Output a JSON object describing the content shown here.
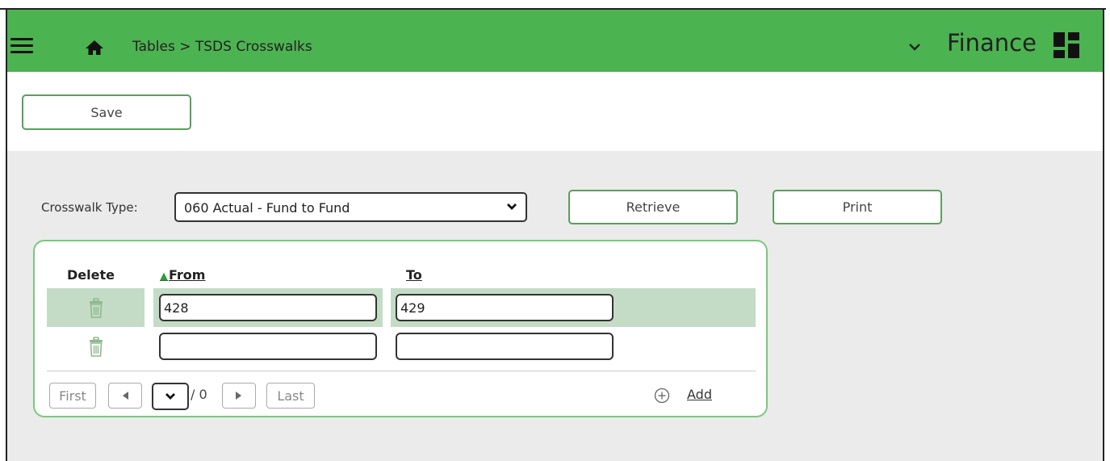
{
  "header": {
    "breadcrumb": "Tables > TSDS Crosswalks",
    "app_title": "Finance",
    "colors": {
      "header_bg": "#4cb351",
      "accent_border": "#5b9e5e",
      "row_highlight": "#c4dcc6"
    },
    "icons": [
      "hamburger-menu-icon",
      "home-icon",
      "chevron-down-icon",
      "grid-layout-icon"
    ]
  },
  "toolbar": {
    "save_label": "Save"
  },
  "crosswalk": {
    "label": "Crosswalk Type:",
    "selected": "060 Actual - Fund to Fund",
    "retrieve_label": "Retrieve",
    "print_label": "Print"
  },
  "grid": {
    "columns": {
      "delete": "Delete",
      "from": "From",
      "to": "To"
    },
    "sort": "from-ascending",
    "rows": [
      {
        "from": "428",
        "to": "429",
        "selected": true
      },
      {
        "from": "",
        "to": "",
        "selected": false
      }
    ],
    "pager": {
      "first": "First",
      "last": "Last",
      "total": "/ 0"
    },
    "add_label": "Add"
  }
}
